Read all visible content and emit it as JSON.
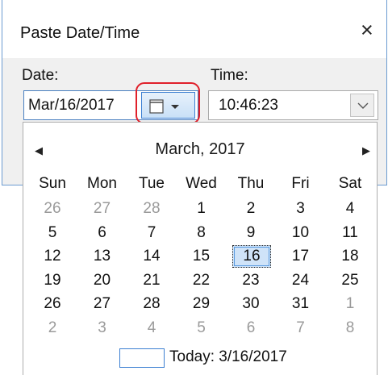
{
  "dialog": {
    "title": "Paste Date/Time",
    "close_glyph": "×",
    "date_label": "Date:",
    "date_value": "Mar/16/2017",
    "time_label": "Time:",
    "time_value": "10:46:23"
  },
  "calendar": {
    "month_title": "March, 2017",
    "prev_glyph": "◀",
    "next_glyph": "▶",
    "weekdays": [
      "Sun",
      "Mon",
      "Tue",
      "Wed",
      "Thu",
      "Fri",
      "Sat"
    ],
    "weeks": [
      [
        {
          "d": "26",
          "dim": true
        },
        {
          "d": "27",
          "dim": true
        },
        {
          "d": "28",
          "dim": true
        },
        {
          "d": "1"
        },
        {
          "d": "2"
        },
        {
          "d": "3"
        },
        {
          "d": "4"
        }
      ],
      [
        {
          "d": "5"
        },
        {
          "d": "6"
        },
        {
          "d": "7"
        },
        {
          "d": "8"
        },
        {
          "d": "9"
        },
        {
          "d": "10"
        },
        {
          "d": "11"
        }
      ],
      [
        {
          "d": "12"
        },
        {
          "d": "13"
        },
        {
          "d": "14"
        },
        {
          "d": "15"
        },
        {
          "d": "16",
          "sel": true
        },
        {
          "d": "17"
        },
        {
          "d": "18"
        }
      ],
      [
        {
          "d": "19"
        },
        {
          "d": "20"
        },
        {
          "d": "21"
        },
        {
          "d": "22"
        },
        {
          "d": "23"
        },
        {
          "d": "24"
        },
        {
          "d": "25"
        }
      ],
      [
        {
          "d": "26"
        },
        {
          "d": "27"
        },
        {
          "d": "28"
        },
        {
          "d": "29"
        },
        {
          "d": "30"
        },
        {
          "d": "31"
        },
        {
          "d": "1",
          "dim": true
        }
      ],
      [
        {
          "d": "2",
          "dim": true
        },
        {
          "d": "3",
          "dim": true
        },
        {
          "d": "4",
          "dim": true
        },
        {
          "d": "5",
          "dim": true
        },
        {
          "d": "6",
          "dim": true
        },
        {
          "d": "7",
          "dim": true
        },
        {
          "d": "8",
          "dim": true
        }
      ]
    ],
    "today_label": "Today: 3/16/2017"
  },
  "colors": {
    "accent": "#3c7fd2",
    "highlight": "#e0202a",
    "dim_text": "#9a9a9a"
  },
  "icons": {
    "calendar_button": "calendar-icon",
    "time_dropdown": "chevron-down-icon"
  }
}
